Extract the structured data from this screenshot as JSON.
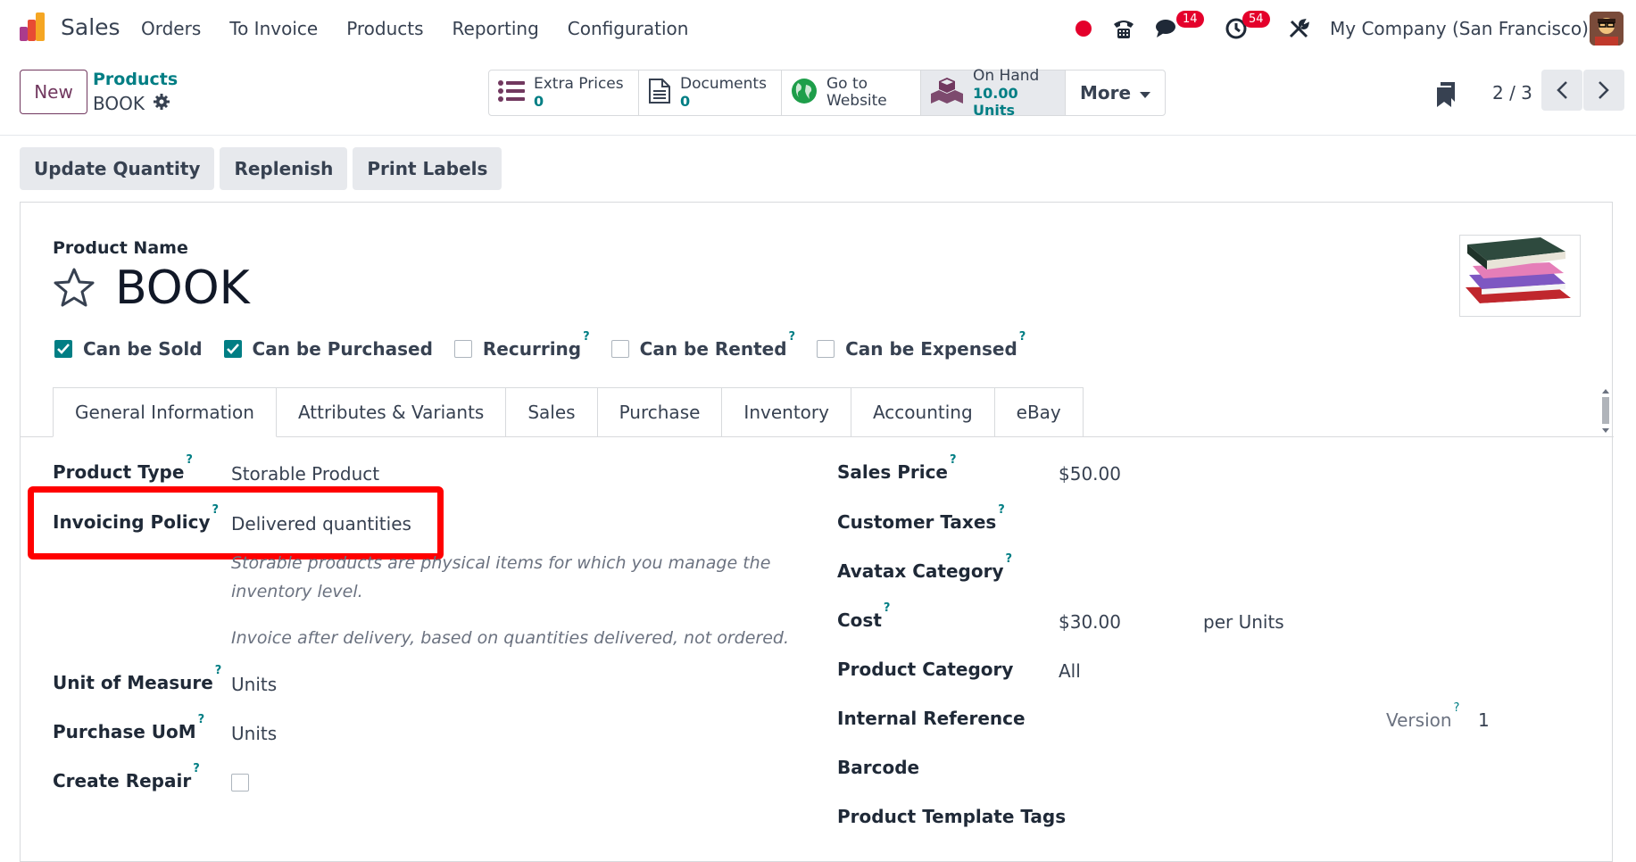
{
  "navbar": {
    "app_name": "Sales",
    "menu": [
      "Orders",
      "To Invoice",
      "Products",
      "Reporting",
      "Configuration"
    ],
    "messages_badge": "14",
    "activities_badge": "54",
    "company": "My Company (San Francisco)"
  },
  "control": {
    "new_label": "New",
    "breadcrumb_parent": "Products",
    "breadcrumb_current": "BOOK",
    "smart_buttons": {
      "extra_prices_label": "Extra Prices",
      "extra_prices_value": "0",
      "documents_label": "Documents",
      "documents_value": "0",
      "website_line1": "Go to",
      "website_line2": "Website",
      "onhand_label": "On Hand",
      "onhand_value": "10.00 Units",
      "more_label": "More"
    },
    "pager": "2 / 3"
  },
  "actions": [
    "Update Quantity",
    "Replenish",
    "Print Labels"
  ],
  "form": {
    "product_name_label": "Product Name",
    "product_name": "BOOK",
    "checkboxes": {
      "can_be_sold": "Can be Sold",
      "can_be_purchased": "Can be Purchased",
      "recurring": "Recurring",
      "can_be_rented": "Can be Rented",
      "can_be_expensed": "Can be Expensed"
    },
    "tabs": [
      "General Information",
      "Attributes & Variants",
      "Sales",
      "Purchase",
      "Inventory",
      "Accounting",
      "eBay"
    ],
    "left": {
      "product_type_label": "Product Type",
      "product_type_value": "Storable Product",
      "invoicing_policy_label": "Invoicing Policy",
      "invoicing_policy_value": "Delivered quantities",
      "help_storable_1": "Storable products are physical items for which you manage the",
      "help_storable_2": "inventory level.",
      "help_invoice": "Invoice after delivery, based on quantities delivered, not ordered.",
      "uom_label": "Unit of Measure",
      "uom_value": "Units",
      "purchase_uom_label": "Purchase UoM",
      "purchase_uom_value": "Units",
      "create_repair_label": "Create Repair"
    },
    "right": {
      "sales_price_label": "Sales Price",
      "sales_price_value": "$50.00",
      "customer_taxes_label": "Customer Taxes",
      "avatax_label": "Avatax Category",
      "cost_label": "Cost",
      "cost_value": "$30.00",
      "cost_unit": "per Units",
      "category_label": "Product Category",
      "category_value": "All",
      "internal_ref_label": "Internal Reference",
      "version_label": "Version",
      "version_value": "1",
      "barcode_label": "Barcode",
      "template_tags_label": "Product Template Tags"
    },
    "help_mark": "?"
  },
  "colors": {
    "brand": "#71385f",
    "accent": "#017e84",
    "badge": "#e4002b",
    "highlight": "#ff0000"
  }
}
